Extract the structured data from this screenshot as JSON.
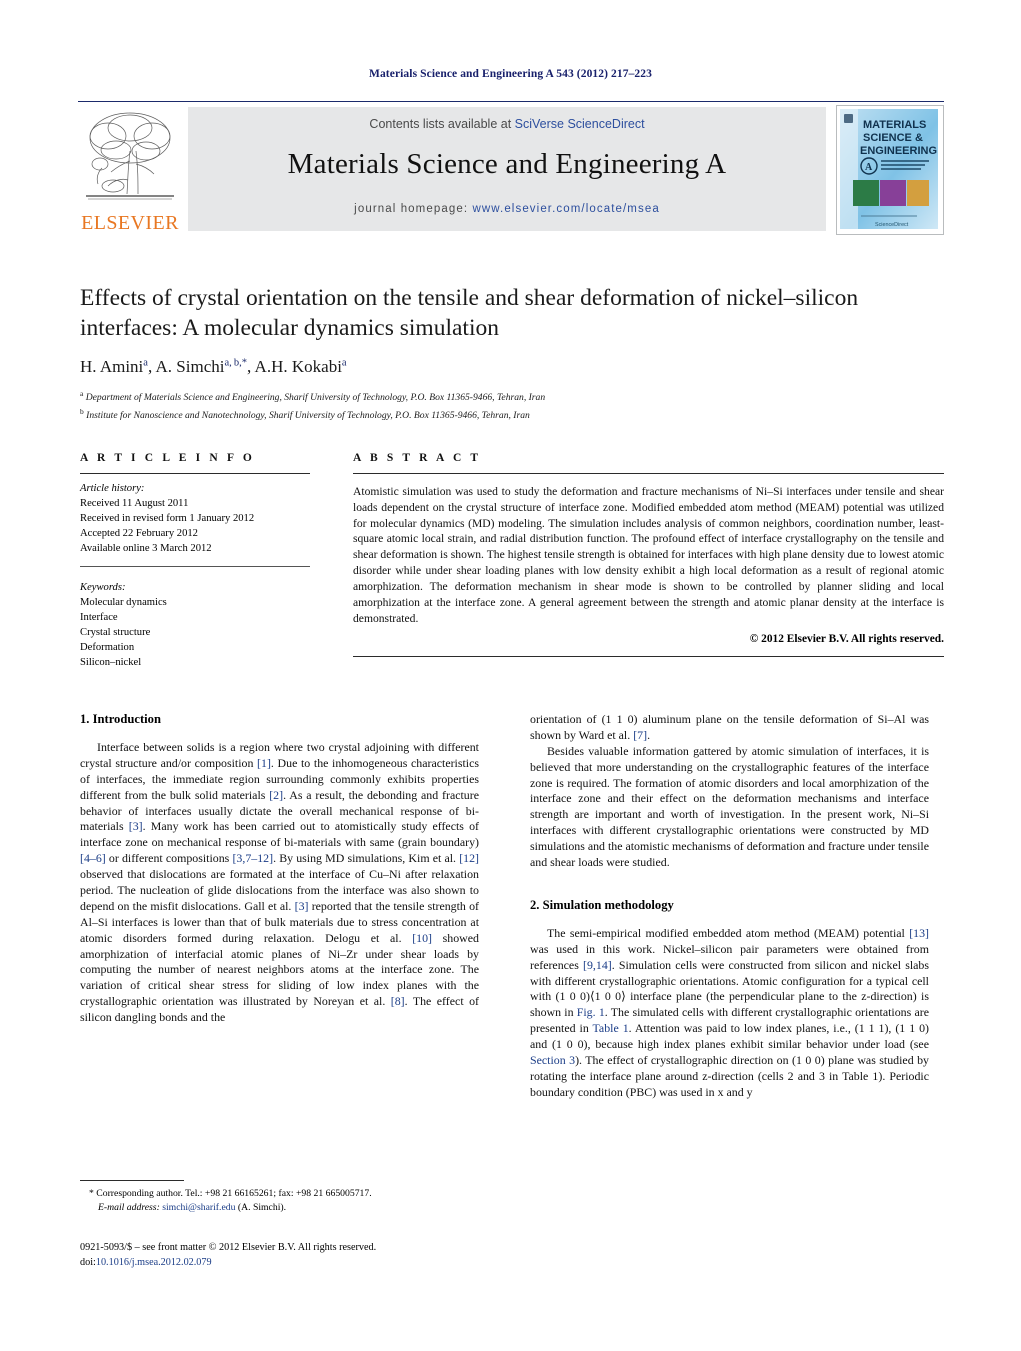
{
  "running_head": "Materials Science and Engineering A 543 (2012) 217–223",
  "masthead": {
    "publisher_name": "ELSEVIER",
    "contents_prefix": "Contents lists available at ",
    "contents_link": "SciVerse ScienceDirect",
    "journal_title": "Materials Science and Engineering A",
    "homepage_prefix": "journal homepage: ",
    "homepage_url": "www.elsevier.com/locate/msea",
    "cover": {
      "line1": "MATERIALS",
      "line2": "SCIENCE &",
      "line3": "ENGINEERING",
      "badge": "A",
      "subtitle": "STRUCTURAL MATERIALS: PROPERTIES, Microstructure and Processing",
      "footer": "ScienceDirect"
    },
    "link_color": "#2d4f9e",
    "rule_color": "#1b2a6b",
    "band_color": "#e6e7e8",
    "brand_orange": "#e87722"
  },
  "title_block": {
    "title": "Effects of crystal orientation on the tensile and shear deformation of nickel–silicon interfaces: A molecular dynamics simulation",
    "authors": "H. Aminiᵃ, A. Simchiᵃ,ᵇ,*, A.H. Kokabiᵃ",
    "authors_plain": "H. Amini, A. Simchi, A.H. Kokabi",
    "affiliations": [
      {
        "marker": "a",
        "text": "Department of Materials Science and Engineering, Sharif University of Technology, P.O. Box 11365-9466, Tehran, Iran"
      },
      {
        "marker": "b",
        "text": "Institute for Nanoscience and Nanotechnology, Sharif University of Technology, P.O. Box 11365-9466, Tehran, Iran"
      }
    ]
  },
  "article_info": {
    "heading": "A R T I C L E    I N F O",
    "history_label": "Article history:",
    "history": [
      "Received 11 August 2011",
      "Received in revised form 1 January 2012",
      "Accepted 22 February 2012",
      "Available online 3 March 2012"
    ],
    "keywords_label": "Keywords:",
    "keywords": [
      "Molecular dynamics",
      "Interface",
      "Crystal structure",
      "Deformation",
      "Silicon–nickel"
    ]
  },
  "abstract": {
    "heading": "A B S T R A C T",
    "text": "Atomistic simulation was used to study the deformation and fracture mechanisms of Ni–Si interfaces under tensile and shear loads dependent on the crystal structure of interface zone. Modified embedded atom method (MEAM) potential was utilized for molecular dynamics (MD) modeling. The simulation includes analysis of common neighbors, coordination number, least-square atomic local strain, and radial distribution function. The profound effect of interface crystallography on the tensile and shear deformation is shown. The highest tensile strength is obtained for interfaces with high plane density due to lowest atomic disorder while under shear loading planes with low density exhibit a high local deformation as a result of regional atomic amorphization. The deformation mechanism in shear mode is shown to be controlled by planner sliding and local amorphization at the interface zone. A general agreement between the strength and atomic planar density at the interface is demonstrated.",
    "copyright": "© 2012 Elsevier B.V. All rights reserved."
  },
  "sections": {
    "intro_heading": "1.  Introduction",
    "method_heading": "2.  Simulation methodology",
    "left_p1_a": "Interface between solids is a region where two crystal adjoining with different crystal structure and/or composition ",
    "left_p1_r1": "[1]",
    "left_p1_b": ". Due to the inhomogeneous characteristics of interfaces, the immediate region surrounding commonly exhibits properties different from the bulk solid materials ",
    "left_p1_r2": "[2]",
    "left_p1_c": ". As a result, the debonding and fracture behavior of interfaces usually dictate the overall mechanical response of bi-materials ",
    "left_p1_r3": "[3]",
    "left_p1_d": ". Many work has been carried out to atomistically study effects of interface zone on mechanical response of bi-materials with same (grain boundary) ",
    "left_p1_r4": "[4–6]",
    "left_p1_e": " or different compositions ",
    "left_p1_r5": "[3,7–12]",
    "left_p1_f": ". By using MD simulations, Kim et al. ",
    "left_p1_r6": "[12]",
    "left_p1_g": " observed that dislocations are formated at the interface of Cu–Ni after relaxation period. The nucleation of glide dislocations from the interface was also shown to depend on the misfit dislocations. Gall et al. ",
    "left_p1_r7": "[3]",
    "left_p1_h": " reported that the tensile strength of Al–Si interfaces is lower than that of bulk materials due to stress concentration at atomic disorders formed during relaxation. Delogu et al. ",
    "left_p1_r8": "[10]",
    "left_p1_i": " showed amorphization of interfacial atomic planes of Ni–Zr under shear loads by computing the number of nearest neighbors atoms at the interface zone. The variation of critical shear stress for sliding of low index planes with the crystallographic orientation was illustrated by Noreyan et al. ",
    "left_p1_r9": "[8]",
    "left_p1_j": ". The effect of silicon dangling bonds and the",
    "right_p1_a": "orientation of (1 1 0) aluminum plane on the tensile deformation of Si–Al was shown by Ward et al. ",
    "right_p1_r1": "[7]",
    "right_p1_b": ".",
    "right_p2": "Besides valuable information gattered by atomic simulation of interfaces, it is believed that more understanding on the crystallographic features of the interface zone is required. The formation of atomic disorders and local amorphization of the interface zone and their effect on the deformation mechanisms and interface strength are important and worth of investigation. In the present work, Ni–Si interfaces with different crystallographic orientations were constructed by MD simulations and the atomistic mechanisms of deformation and fracture under tensile and shear loads were studied.",
    "right_p3_a": "The semi-empirical modified embedded atom method (MEAM) potential ",
    "right_p3_r1": "[13]",
    "right_p3_b": " was used in this work. Nickel–silicon pair parameters were obtained from references ",
    "right_p3_r2": "[9,14]",
    "right_p3_c": ". Simulation cells were constructed from silicon and nickel slabs with different crystallographic orientations. Atomic configuration for a typical cell with (1 0 0)⟨1 0 0⟩ interface plane (the perpendicular plane to the z-direction) is shown in ",
    "right_p3_r3": "Fig. 1",
    "right_p3_d": ". The simulated cells with different crystallographic orientations are presented in ",
    "right_p3_r4": "Table 1",
    "right_p3_e": ". Attention was paid to low index planes, i.e., (1 1 1), (1 1 0) and (1 0 0), because high index planes exhibit similar behavior under load (see ",
    "right_p3_r5": "Section 3",
    "right_p3_f": "). The effect of crystallographic direction on (1 0 0) plane was studied by rotating the interface plane around z-direction (cells 2 and 3 in Table 1). Periodic boundary condition (PBC) was used in x and y"
  },
  "footnote": {
    "star": "*",
    "corresponding": " Corresponding author. Tel.: +98 21 66165261; fax: +98 21 665005717.",
    "email_label": "E-mail address:",
    "email": "simchi@sharif.edu",
    "email_suffix": " (A. Simchi)."
  },
  "imprint": {
    "issn_line": "0921-5093/$ – see front matter © 2012 Elsevier B.V. All rights reserved.",
    "doi_label": "doi:",
    "doi": "10.1016/j.msea.2012.02.079"
  }
}
